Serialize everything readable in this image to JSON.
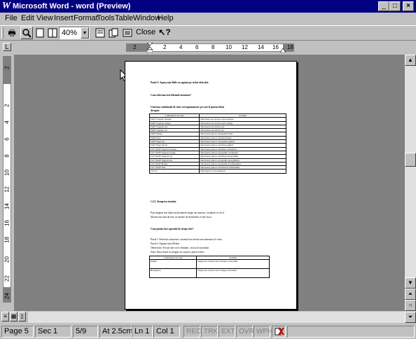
{
  "window": {
    "title": "Microsoft Word - word (Preview)",
    "icon": "word-icon",
    "controls": [
      "minimize-icon",
      "maximize-icon",
      "close-icon"
    ]
  },
  "menu": [
    "File",
    "Edit",
    "View",
    "Insert",
    "Format",
    "Tools",
    "Table",
    "Window",
    "Help"
  ],
  "toolbar": {
    "zoom": "40%",
    "close_label": "Close"
  },
  "hruler": [
    "2",
    "2",
    "4",
    "6",
    "8",
    "10",
    "12",
    "14",
    "16",
    "18"
  ],
  "vruler": [
    "2",
    "2",
    "4",
    "6",
    "8",
    "10",
    "12",
    "14",
    "16",
    "18",
    "20",
    "22",
    "24"
  ],
  "document": {
    "line1": "Pasul 3: Apasa una Shift cu sageata pe teclar dela alta",
    "line2": "Cum selectam text folosind tastatura?",
    "line3": "Urmeaza combinatii de taste corespunzatoare pe care le putem folosi",
    "line4": "dreapta.",
    "table1_header": [
      "Combinatie de taste",
      "Actiune"
    ],
    "table1_rows": [
      [
        "Shift+Sageata dreapta",
        "Selecteaza un caracter spre dreapta"
      ],
      [
        "Shift+Sageata stanga",
        "Selecteaza un caracter spre stanga"
      ],
      [
        "Shift+Sageata sus",
        "Selecteaza un rand in sus"
      ],
      [
        "Shift+Sageata jos",
        "Selecteaza un rand in jos"
      ],
      [
        "Shift+Home",
        "Selecteaza pana la inceputul liniei"
      ],
      [
        "Shift+End",
        "Selecteaza pana la sfarsitul liniei"
      ],
      [
        "Shift+Page Up",
        "Selecteaza pana la inceputul paginii"
      ],
      [
        "Shift+Page Down",
        "Selecteaza pana la sfarsitul paginii"
      ],
      [
        "Ctrl+Shift+Sageata dreapta",
        "Selecteaza pana la sfarsitul cuvantului"
      ],
      [
        "Ctrl+Shift+Sageata stanga",
        "Selecteaza pana la inceputul cuvantului"
      ],
      [
        "Ctrl+Shift+Sageata jos",
        "Selecteaza pana la sfarsitul paragrafului"
      ],
      [
        "Ctrl+Shift+Sageata sus",
        "Selecteaza pana la inceputul paragrafului"
      ],
      [
        "Ctrl+Shift+Home",
        "Selecteaza pana la inceputul documentului"
      ],
      [
        "Ctrl+Shift+End",
        "Selecteaza pana la sfarsitul documentului"
      ],
      [
        "Ctrl+A",
        "Selecteaza tot documentul"
      ]
    ],
    "section": "1.2.5. Stergerea textului",
    "para1": "Pop stergem text dintr-un document sterge un caracter, cuvintele ce vor fi",
    "para2": "blocate sau sunt de text, in functie de document ce este in uz.",
    "line_q": "Cum putem face operatii de sterge text?",
    "step1": "Pasul 1: Selectati caracterul, cuvantul sau textul care urmeaza a fi sters.",
    "step2": "Pasul 2: Apasati tasta Delete.",
    "obs1": "Observatie: Textul sters va fi eliminat ; in locul cursorului",
    "obs2": "Nota: Daca doriti sa stergeti un caracter, puteti folosi:",
    "table2_header": [
      "Combinatie de taste",
      "Actiune"
    ],
    "table2_rows": [
      [
        "Delete",
        "Sterge un caracter de la dreapta cursorului"
      ],
      [
        "Backspace",
        "Sterge un caracter de la stanga cursorului"
      ]
    ]
  },
  "status": {
    "page": "Page 5",
    "sec": "Sec 1",
    "pages": "5/9",
    "at": "At 2.5cm",
    "ln": "Ln 1",
    "col": "Col 1",
    "rec": "REC",
    "trk": "TRK",
    "ext": "EXT",
    "ovr": "OVR",
    "wph": "WPH"
  }
}
